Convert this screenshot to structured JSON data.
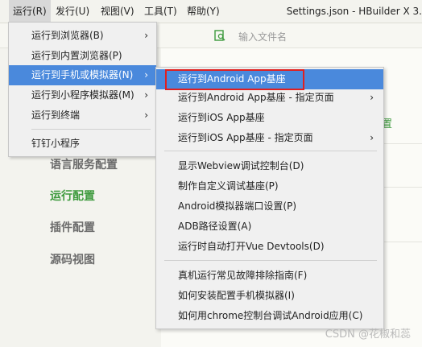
{
  "menubar": {
    "items": [
      {
        "label": "运行(R)"
      },
      {
        "label": "发行(U)"
      },
      {
        "label": "视图(V)"
      },
      {
        "label": "工具(T)"
      },
      {
        "label": "帮助(Y)"
      }
    ],
    "window_title": "Settings.json - HBuilder X 3."
  },
  "editor": {
    "file_search_placeholder": "输入文件名"
  },
  "settings_nav": {
    "items": [
      "语言服务配置",
      "运行配置",
      "插件配置",
      "源码视图"
    ],
    "right_partial": "置"
  },
  "run_menu": {
    "items": [
      {
        "label": "运行到浏览器(B)",
        "submenu": true
      },
      {
        "label": "运行到内置浏览器(P)",
        "submenu": false
      },
      {
        "label": "运行到手机或模拟器(N)",
        "submenu": true
      },
      {
        "label": "运行到小程序模拟器(M)",
        "submenu": true
      },
      {
        "label": "运行到终端",
        "submenu": true
      },
      {
        "label": "钉钉小程序",
        "submenu": false
      }
    ],
    "arrow_glyph": "›"
  },
  "phone_submenu": {
    "items": [
      {
        "label": "运行到Android App基座"
      },
      {
        "label": "运行到Android App基座 - 指定页面"
      },
      {
        "label": "运行到iOS App基座"
      },
      {
        "label": "运行到iOS App基座 - 指定页面"
      },
      {
        "label": "显示Webview调试控制台(D)"
      },
      {
        "label": "制作自定义调试基座(P)"
      },
      {
        "label": "Android模拟器端口设置(P)"
      },
      {
        "label": "ADB路径设置(A)"
      },
      {
        "label": "运行时自动打开Vue Devtools(D)"
      },
      {
        "label": "真机运行常见故障排除指南(F)"
      },
      {
        "label": "如何安装配置手机模拟器(I)"
      },
      {
        "label": "如何用chrome控制台调试Android应用(C)"
      }
    ]
  },
  "watermark": "CSDN @花椒和蕊",
  "colors": {
    "highlight": "#4a89dc",
    "annotation_box": "#e02020",
    "accent_green": "#3d9a3d"
  }
}
